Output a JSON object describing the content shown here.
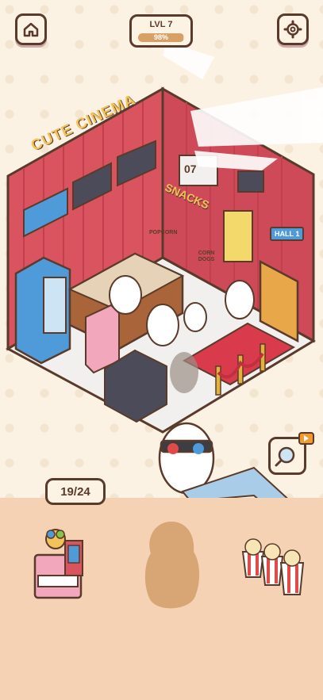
{
  "hud": {
    "home_icon": "home-icon",
    "settings_icon": "gear-icon",
    "level_label": "LVL 7",
    "progress_label": "98%",
    "progress_fraction": 0.98
  },
  "room": {
    "sign_title": "CUTE CINEMA",
    "snacks_sign": "SNACKS",
    "hall_sign": "HALL 1",
    "popcorn_box": "POPCORN",
    "corn_dogs": "CORN DOGS",
    "clock": "07"
  },
  "items": {
    "counter_label": "19/24",
    "tray": [
      "drink-machine",
      "silhouette-slot",
      "popcorn-buckets"
    ]
  },
  "colors": {
    "wall": "#d9545f",
    "floor": "#f2f0ee",
    "carpet": "#d93b4d",
    "accent": "#4f9ad8"
  }
}
